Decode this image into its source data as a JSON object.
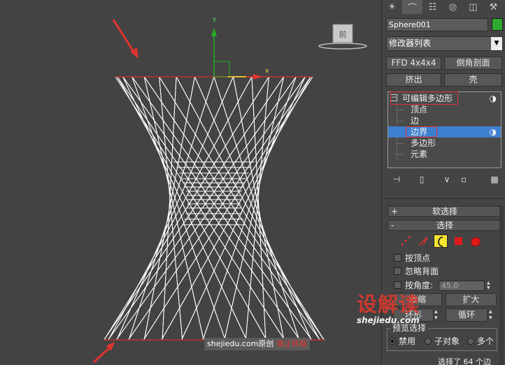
{
  "viewport": {
    "axis_x": "x",
    "axis_y": "y",
    "viewcube_label": "前",
    "watermark_site": "shejiedu.com",
    "watermark_original": "原创",
    "watermark_ban": "禁止转载",
    "mesh_color": "#ffffff",
    "border_color": "#c0322c",
    "arrow_color": "#e0342f"
  },
  "panel": {
    "tabs": [
      "sun-icon",
      "modify-icon",
      "hierarchy-icon",
      "motion-icon",
      "display-icon",
      "utilities-icon"
    ],
    "object_name": "Sphere001",
    "object_color": "#2fa92f",
    "modifier_list": "修改器列表",
    "buttons": {
      "ffd": "FFD 4x4x4",
      "chamfer": "倒角剖面",
      "extrude": "挤出",
      "shell": "壳"
    },
    "stack": {
      "root": "可编辑多边形",
      "items": [
        "顶点",
        "边",
        "边界",
        "多边形",
        "元素"
      ],
      "selected_index": 2
    },
    "rollouts": {
      "soft_selection": "软选择",
      "soft_pm": "+",
      "selection": "选择",
      "selection_pm": "-"
    },
    "checkboxes": {
      "by_vertex": "按顶点",
      "ignore_backfacing": "忽略背面",
      "by_angle": "按角度:"
    },
    "angle_value": "45.0",
    "buttons2": {
      "shrink": "收缩",
      "grow": "扩大",
      "ring": "环形",
      "loop": "循环"
    },
    "preview_selection": {
      "label": "预览选择",
      "options": [
        "禁用",
        "子对象",
        "多个"
      ],
      "selected": 0
    },
    "status": "选择了 64 个边"
  },
  "watermark": {
    "brand": "设解读",
    "url": "shejiedu.com"
  }
}
